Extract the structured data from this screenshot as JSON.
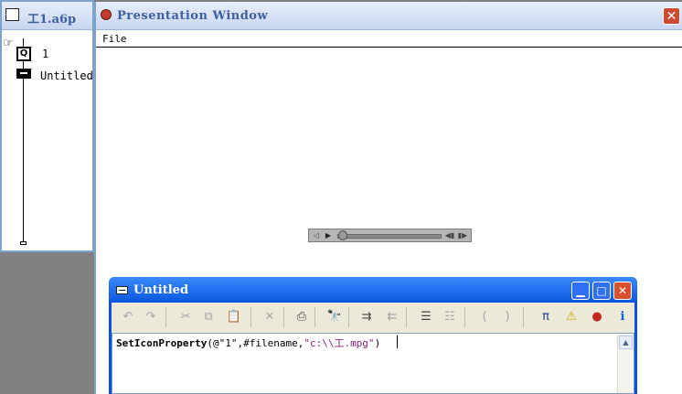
{
  "flow_window": {
    "title": "工1.a6p",
    "icons": [
      {
        "label": "1",
        "type": "wait-icon"
      },
      {
        "label": "Untitled",
        "type": "calculation-icon"
      }
    ]
  },
  "presentation_window": {
    "title": "Presentation Window",
    "close_label": "✕",
    "menu": [
      "File"
    ],
    "media_controller": {
      "volume_icon": "speaker-icon",
      "play_icon": "play-icon",
      "progress": 0.0,
      "back_icon": "step-back-icon",
      "forward_icon": "step-forward-icon"
    }
  },
  "calc_window": {
    "title": "Untitled",
    "buttons": {
      "minimize": "▁",
      "maximize": "□",
      "close": "✕"
    },
    "toolbar": [
      {
        "icon": "undo-icon",
        "glyph": "↶",
        "enabled": false
      },
      {
        "icon": "redo-icon",
        "glyph": "↷",
        "enabled": false
      },
      {
        "icon": "cut-icon",
        "glyph": "✂",
        "enabled": false
      },
      {
        "icon": "copy-icon",
        "glyph": "⧉",
        "enabled": false
      },
      {
        "icon": "paste-icon",
        "glyph": "📋",
        "enabled": true
      },
      {
        "icon": "delete-icon",
        "glyph": "✕",
        "enabled": false
      },
      {
        "icon": "print-icon",
        "glyph": "⎙",
        "enabled": true
      },
      {
        "icon": "find-icon",
        "glyph": "🔭",
        "enabled": true
      },
      {
        "icon": "indent-icon",
        "glyph": "⇉",
        "enabled": true
      },
      {
        "icon": "outdent-icon",
        "glyph": "⇇",
        "enabled": false
      },
      {
        "icon": "comment-icon",
        "glyph": "☰",
        "enabled": true
      },
      {
        "icon": "uncomment-icon",
        "glyph": "☷",
        "enabled": false
      },
      {
        "icon": "paren-open-icon",
        "glyph": "(",
        "enabled": false
      },
      {
        "icon": "paren-close-icon",
        "glyph": ")",
        "enabled": false
      },
      {
        "icon": "symbols-icon",
        "glyph": "π",
        "enabled": true
      },
      {
        "icon": "warning-icon",
        "glyph": "⚠",
        "enabled": true
      },
      {
        "icon": "record-icon",
        "glyph": "●",
        "enabled": true
      },
      {
        "icon": "info-icon",
        "glyph": "ℹ",
        "enabled": true
      }
    ],
    "code": {
      "fn": "SetIconProperty",
      "open": "(@\"",
      "arg1": "1",
      "mid": "\",#filename,",
      "str": "\"c:\\\\工.mpg\"",
      "close": ")"
    }
  },
  "colors": {
    "title_blue": "#0a57e0",
    "code_string": "#8b1f7a",
    "xp_border": "#7da2ce"
  }
}
